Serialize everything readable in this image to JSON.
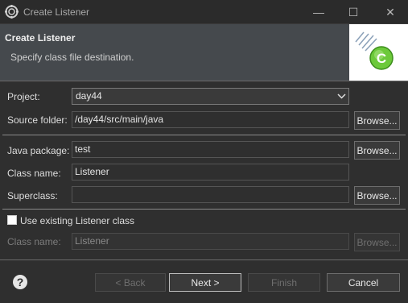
{
  "window": {
    "title": "Create Listener",
    "controls": {
      "minimize": "—",
      "maximize": "☐",
      "close": "✕"
    }
  },
  "banner": {
    "title": "Create Listener",
    "message": "Specify class file destination.",
    "image_icon": "java-class-wizard-icon",
    "image_letter": "C"
  },
  "form": {
    "project": {
      "label": "Project:",
      "value": "day44"
    },
    "source_folder": {
      "label": "Source folder:",
      "value": "/day44/src/main/java",
      "browse": "Browse..."
    },
    "java_package": {
      "label": "Java package:",
      "value": "test",
      "browse": "Browse..."
    },
    "class_name": {
      "label": "Class name:",
      "value": "Listener"
    },
    "superclass": {
      "label": "Superclass:",
      "value": "",
      "browse": "Browse..."
    },
    "use_existing": {
      "label": "Use existing Listener class",
      "checked": false
    },
    "existing_class_name": {
      "label": "Class name:",
      "value": "Listener",
      "browse": "Browse..."
    }
  },
  "footer": {
    "back": "< Back",
    "next": "Next >",
    "finish": "Finish",
    "cancel": "Cancel",
    "help_icon": "help-icon"
  },
  "colors": {
    "background": "#2f2f2f",
    "banner": "#45494d",
    "text": "#dcdcdc",
    "disabled_text": "#7c7c7c",
    "logo_green": "#6cc93a"
  }
}
